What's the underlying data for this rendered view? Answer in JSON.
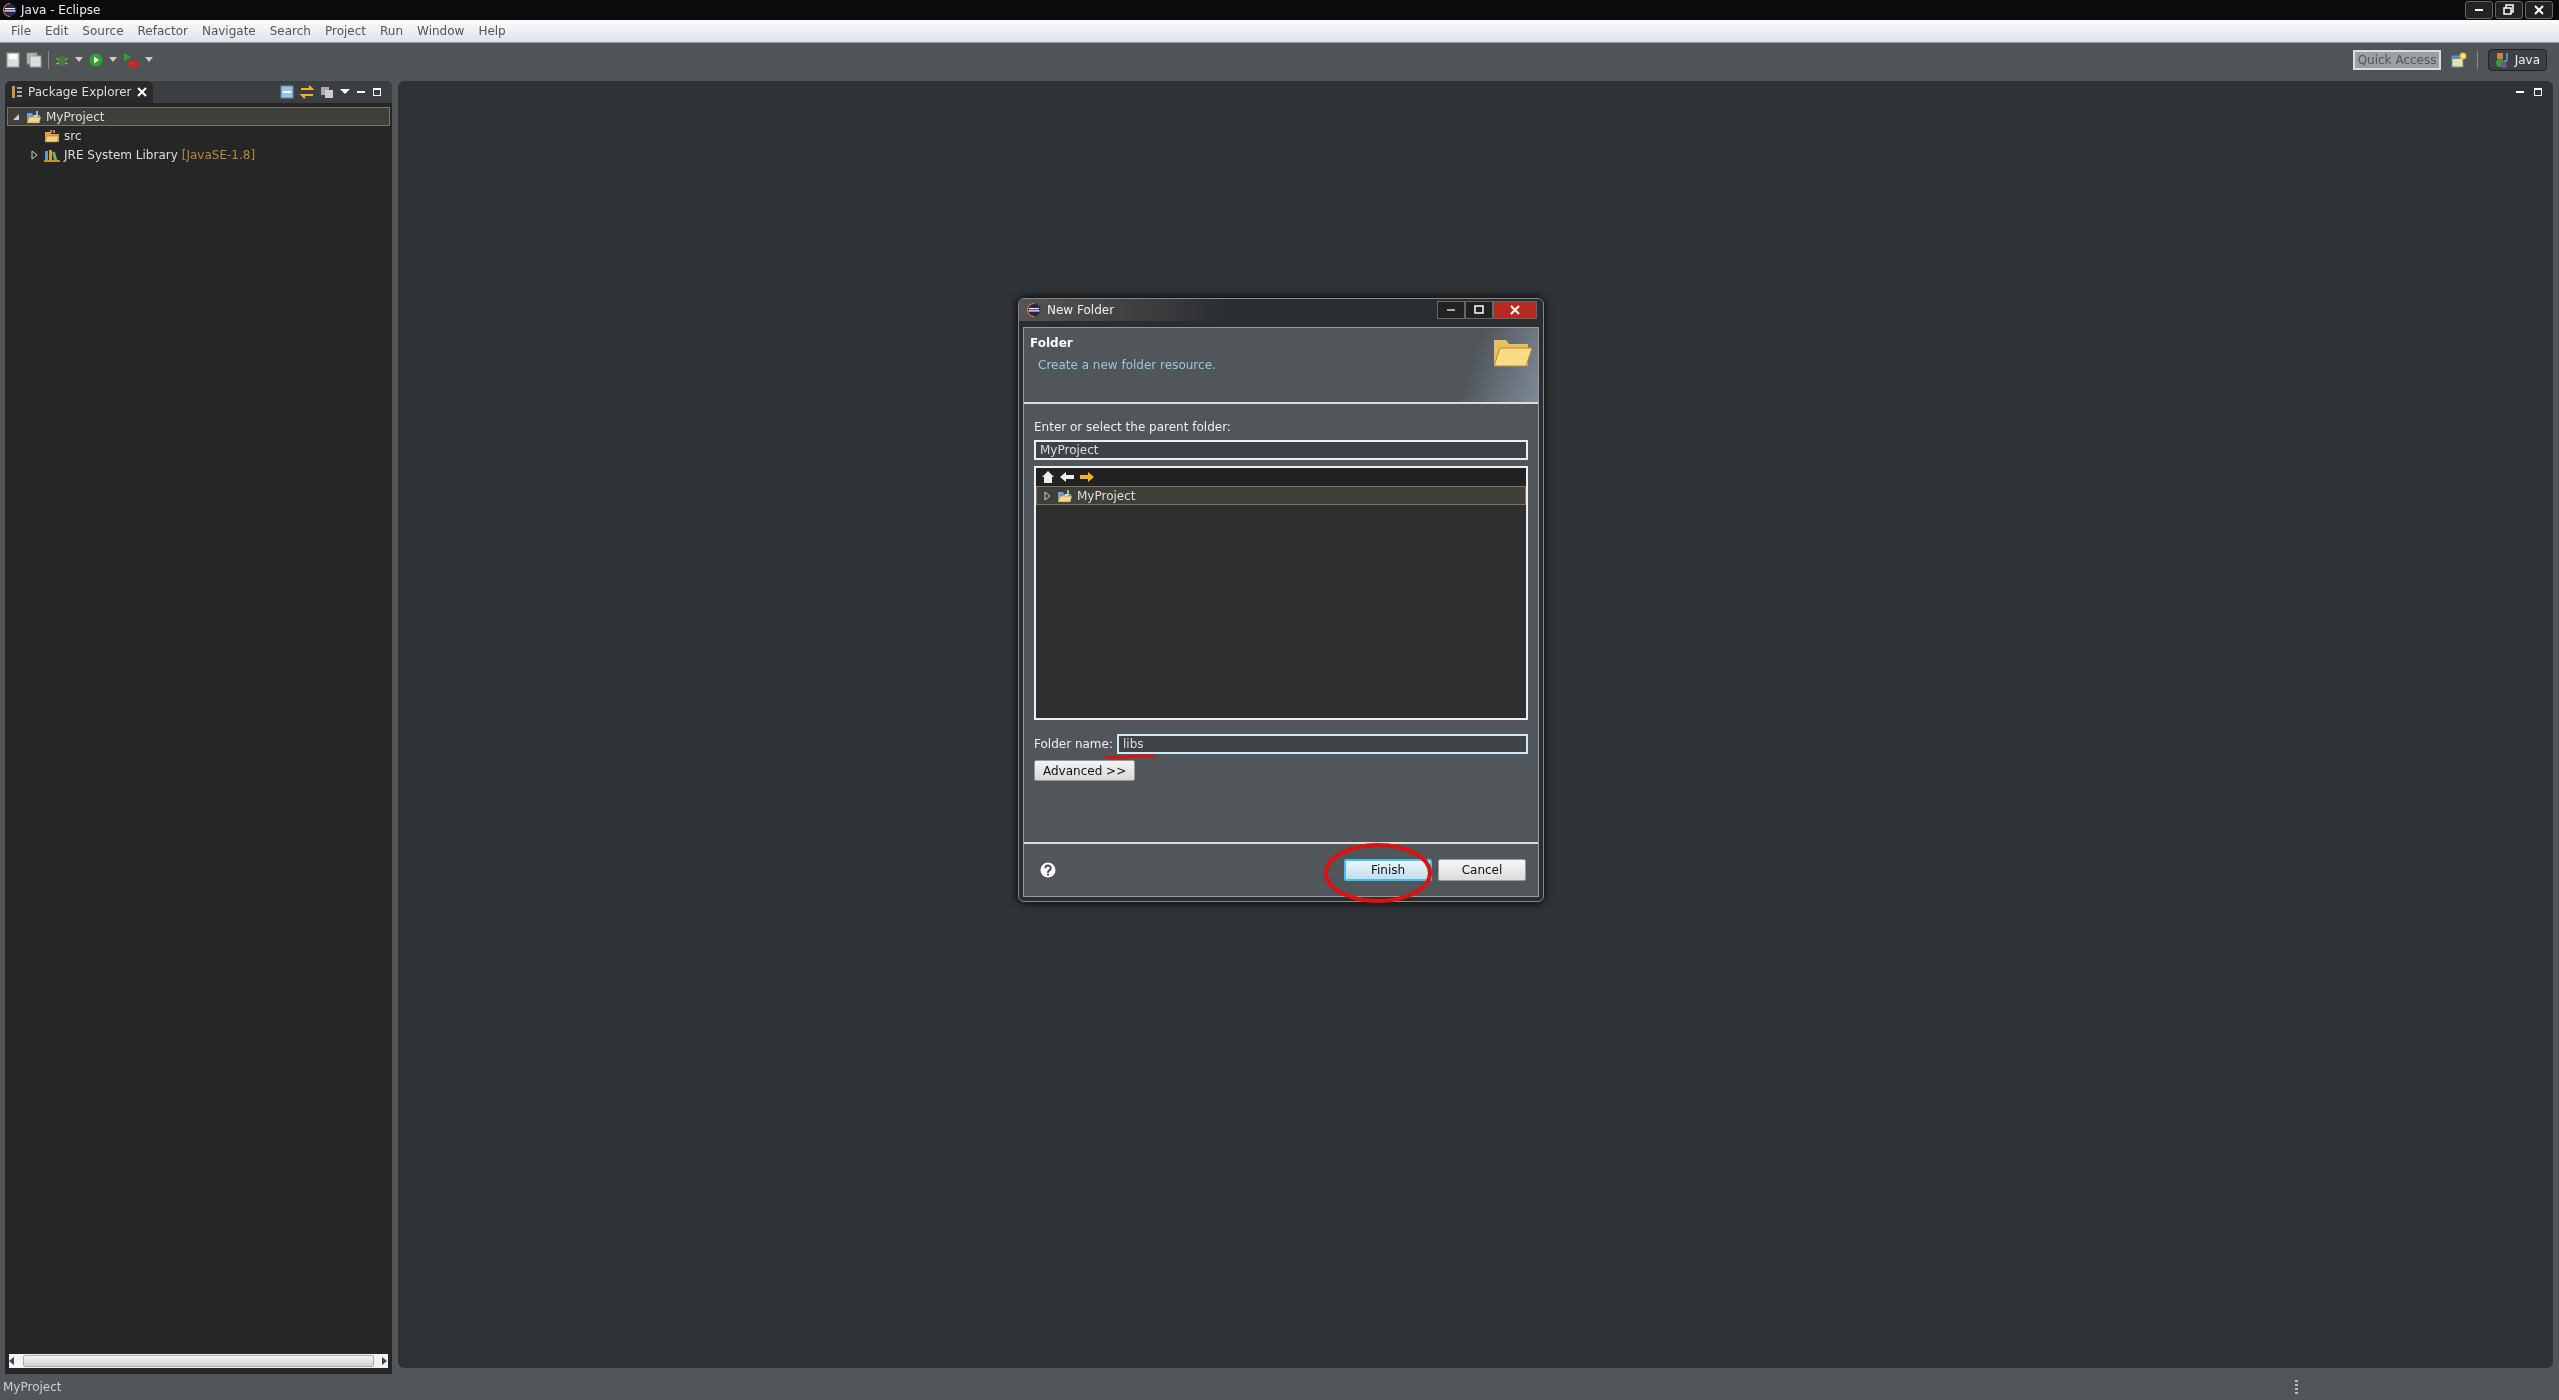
{
  "window": {
    "title": "Java - Eclipse"
  },
  "menu": [
    {
      "label": "File"
    },
    {
      "label": "Edit"
    },
    {
      "label": "Source"
    },
    {
      "label": "Refactor"
    },
    {
      "label": "Navigate"
    },
    {
      "label": "Search"
    },
    {
      "label": "Project"
    },
    {
      "label": "Run"
    },
    {
      "label": "Window"
    },
    {
      "label": "Help"
    }
  ],
  "quick_access": {
    "placeholder": "Quick Access"
  },
  "perspective": {
    "label": "Java",
    "selected": true
  },
  "package_explorer": {
    "title": "Package Explorer",
    "tree": [
      {
        "label": "MyProject",
        "kind": "project",
        "selected": true,
        "expanded": true,
        "children": [
          {
            "label": "src",
            "kind": "folder",
            "selected": false
          },
          {
            "label": "JRE System Library",
            "decoration": "[JavaSE-1.8]",
            "kind": "library",
            "selected": false,
            "expanded": false
          }
        ]
      }
    ]
  },
  "dialog": {
    "title": "New Folder",
    "heading": "Folder",
    "description": "Create a new folder resource.",
    "parent_label": "Enter or select the parent folder:",
    "parent_value": "MyProject",
    "tree": [
      {
        "label": "MyProject",
        "kind": "project",
        "selected": true,
        "expanded": false
      }
    ],
    "name_label": "Folder name:",
    "name_value": "libs",
    "advanced": "Advanced >>",
    "buttons": [
      {
        "label": "Finish",
        "kind": "default"
      },
      {
        "label": "Cancel",
        "kind": "normal"
      }
    ]
  },
  "status_bar": {
    "text": "MyProject"
  }
}
